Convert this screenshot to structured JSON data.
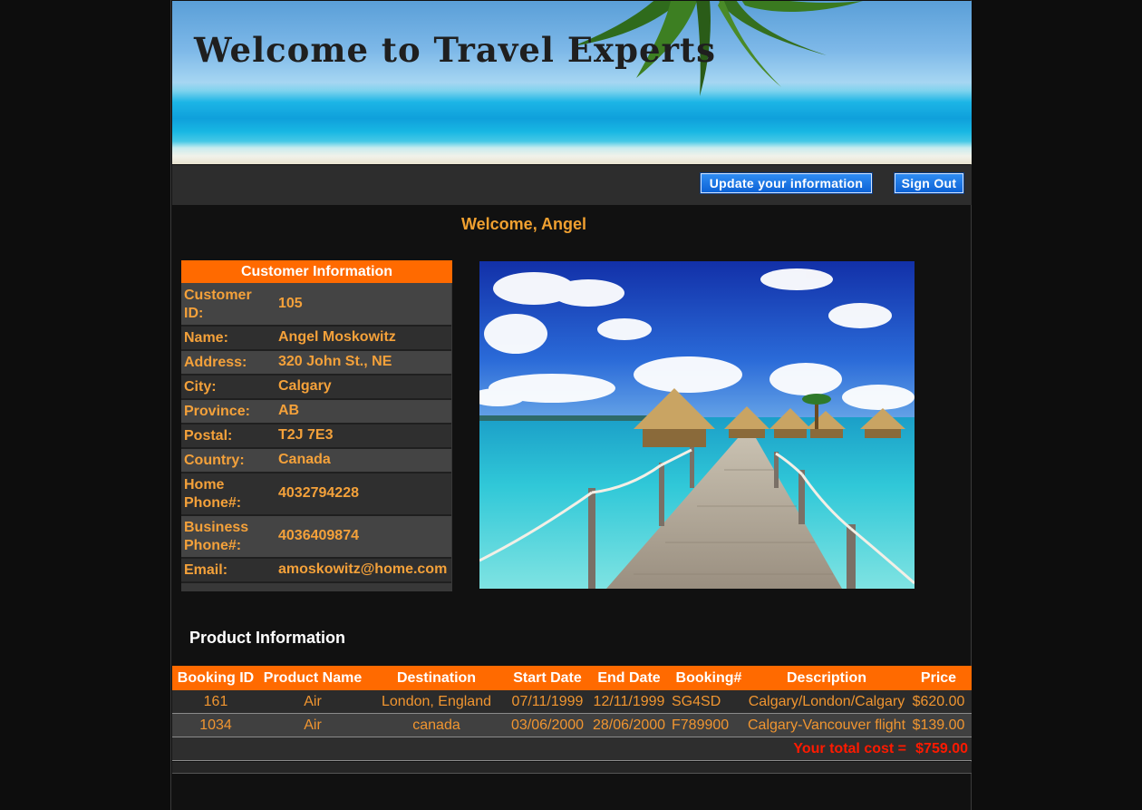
{
  "banner": {
    "title": "Welcome to Travel Experts"
  },
  "toolbar": {
    "update_label": "Update your information",
    "signout_label": "Sign Out"
  },
  "welcome": "Welcome, Angel",
  "customer": {
    "header": "Customer Information",
    "rows": [
      {
        "label": "Customer ID:",
        "value": "105"
      },
      {
        "label": "Name:",
        "value": "Angel Moskowitz"
      },
      {
        "label": "Address:",
        "value": "320 John St., NE"
      },
      {
        "label": "City:",
        "value": "Calgary"
      },
      {
        "label": "Province:",
        "value": "AB"
      },
      {
        "label": "Postal:",
        "value": "T2J 7E3"
      },
      {
        "label": "Country:",
        "value": "Canada"
      },
      {
        "label": "Home Phone#:",
        "value": "4032794228"
      },
      {
        "label": "Business Phone#:",
        "value": "4036409874"
      },
      {
        "label": "Email:",
        "value": "amoskowitz@home.com"
      }
    ]
  },
  "products": {
    "heading": "Product Information",
    "columns": [
      "Booking ID",
      "Product Name",
      "Destination",
      "Start Date",
      "End Date",
      "Booking#",
      "Description",
      "Price"
    ],
    "rows": [
      [
        "161",
        "Air",
        "London, England",
        "07/11/1999",
        "12/11/1999",
        "SG4SD",
        "Calgary/London/Calgary",
        "$620.00"
      ],
      [
        "1034",
        "Air",
        "canada",
        "03/06/2000",
        "28/06/2000",
        "F789900",
        "Calgary-Vancouver flight",
        "$139.00"
      ]
    ],
    "total_label": "Your total cost =",
    "total_value": "$759.00"
  },
  "colors": {
    "accent_orange": "#ff6a00",
    "text_orange": "#f4a13a",
    "total_red": "#ff1a00",
    "button_blue": "#1a6fe0"
  }
}
